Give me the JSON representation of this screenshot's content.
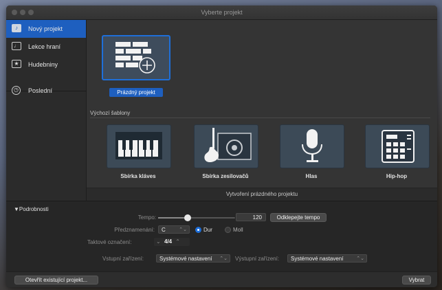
{
  "window": {
    "title": "Vyberte projekt"
  },
  "sidebar": {
    "items": [
      {
        "label": "Nový projekt",
        "icon": "guitar-icon",
        "selected": true
      },
      {
        "label": "Lekce hraní",
        "icon": "music-note-icon",
        "selected": false
      },
      {
        "label": "Hudebniny",
        "icon": "star-icon",
        "selected": false
      },
      {
        "label": "Poslední",
        "icon": "clock-icon",
        "selected": false
      }
    ]
  },
  "main": {
    "empty_project": {
      "label": "Prázdný projekt"
    },
    "templates_heading": "Výchozí šablony",
    "templates": [
      {
        "label": "Sbírka kláves",
        "icon": "keyboard-icon"
      },
      {
        "label": "Sbírka zesilovačů",
        "icon": "guitar-amp-icon"
      },
      {
        "label": "Hlas",
        "icon": "microphone-icon"
      },
      {
        "label": "Hip-hop",
        "icon": "drum-machine-icon"
      }
    ],
    "description": "Vytvoření prázdného projektu"
  },
  "details": {
    "toggle_label": "▼Podrobnosti",
    "tempo": {
      "label": "Tempo:",
      "value": "120",
      "slider_fraction": 0.38,
      "tap_button": "Odklepejte tempo"
    },
    "key_signature": {
      "label": "Předznamenání:",
      "value": "C",
      "major_label": "Dur",
      "minor_label": "Moll",
      "mode": "Dur"
    },
    "time_signature": {
      "label": "Taktové označení:",
      "value": "4/4"
    },
    "input_device": {
      "label": "Vstupní zařízení:",
      "value": "Systémové nastavení"
    },
    "output_device": {
      "label": "Výstupní zařízení:",
      "value": "Systémové nastavení"
    }
  },
  "footer": {
    "open_existing": "Otevřít existující projekt...",
    "choose": "Vybrat"
  },
  "colors": {
    "accent": "#1e5fbf",
    "tile": "#3c4a57"
  }
}
